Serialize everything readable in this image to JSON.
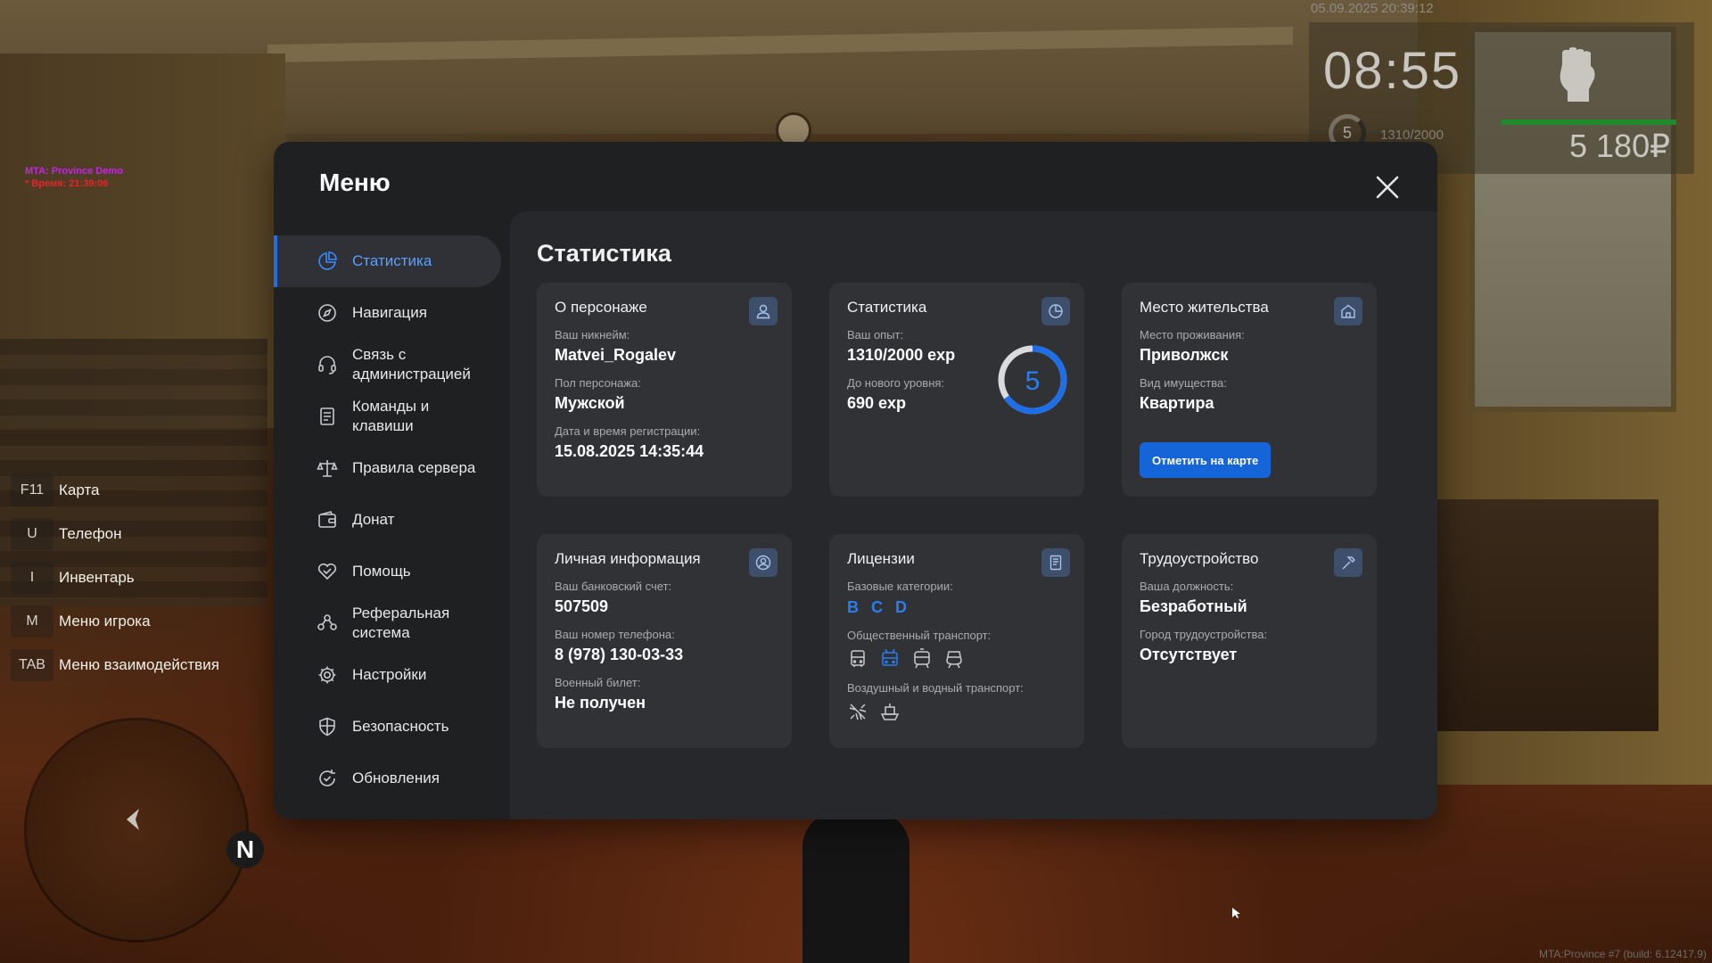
{
  "hud": {
    "datetime": "05.09.2025 20:39:12",
    "time": "08:55",
    "level": "5",
    "exp": "1310/2000",
    "money": "5 180₽",
    "debug_line1": "MTA: Province Demo",
    "debug_line2": "* Время: 21:39:06",
    "build": "MTA:Province #7 (build: 6.12417.9)",
    "compass": "N"
  },
  "hotkeys": [
    {
      "key": "F11",
      "label": "Карта"
    },
    {
      "key": "U",
      "label": "Телефон"
    },
    {
      "key": "I",
      "label": "Инвентарь"
    },
    {
      "key": "M",
      "label": "Меню игрока"
    },
    {
      "key": "TAB",
      "label": "Меню взаимодействия"
    }
  ],
  "menu": {
    "title": "Меню",
    "nav": [
      {
        "label": "Статистика",
        "icon": "chart-pie-icon",
        "active": true
      },
      {
        "label": "Навигация",
        "icon": "compass-icon"
      },
      {
        "label": "Связь с администрацией",
        "icon": "headset-icon"
      },
      {
        "label": "Команды и клавиши",
        "icon": "document-icon"
      },
      {
        "label": "Правила сервера",
        "icon": "scales-icon"
      },
      {
        "label": "Донат",
        "icon": "wallet-icon"
      },
      {
        "label": "Помощь",
        "icon": "handshake-icon"
      },
      {
        "label": "Реферальная система",
        "icon": "people-icon"
      },
      {
        "label": "Настройки",
        "icon": "gear-icon"
      },
      {
        "label": "Безопасность",
        "icon": "shield-icon"
      },
      {
        "label": "Обновления",
        "icon": "refresh-icon"
      }
    ]
  },
  "stats": {
    "title": "Статистика",
    "character": {
      "title": "О персонаже",
      "nick_label": "Ваш никнейм:",
      "nick": "Matvei_Rogalev",
      "gender_label": "Пол персонажа:",
      "gender": "Мужской",
      "reg_label": "Дата и время регистрации:",
      "reg": "15.08.2025 14:35:44"
    },
    "statistics": {
      "title": "Статистика",
      "exp_label": "Ваш опыт:",
      "exp": "1310/2000 exp",
      "next_label": "До нового уровня:",
      "next": "690 exp",
      "level": "5",
      "progress": 0.655
    },
    "residence": {
      "title": "Место жительства",
      "place_label": "Место проживания:",
      "place": "Приволжск",
      "type_label": "Вид имущества:",
      "type": "Квартира",
      "button": "Отметить на карте"
    },
    "personal": {
      "title": "Личная информация",
      "bank_label": "Ваш банковский счет:",
      "bank": "507509",
      "phone_label": "Ваш номер телефона:",
      "phone": "8 (978) 130-03-33",
      "military_label": "Военный билет:",
      "military": "Не получен"
    },
    "licenses": {
      "title": "Лицензии",
      "basic_label": "Базовые категории:",
      "basic": [
        "B",
        "C",
        "D"
      ],
      "public_label": "Общественный транспорт:",
      "air_label": "Воздушный и водный транспорт:"
    },
    "employment": {
      "title": "Трудоустройство",
      "position_label": "Ваша должность:",
      "position": "Безработный",
      "city_label": "Город трудоустройства:",
      "city": "Отсутствует"
    }
  },
  "colors": {
    "accent": "#1e6ee8",
    "panel": "#1f2022",
    "card": "#303236"
  }
}
